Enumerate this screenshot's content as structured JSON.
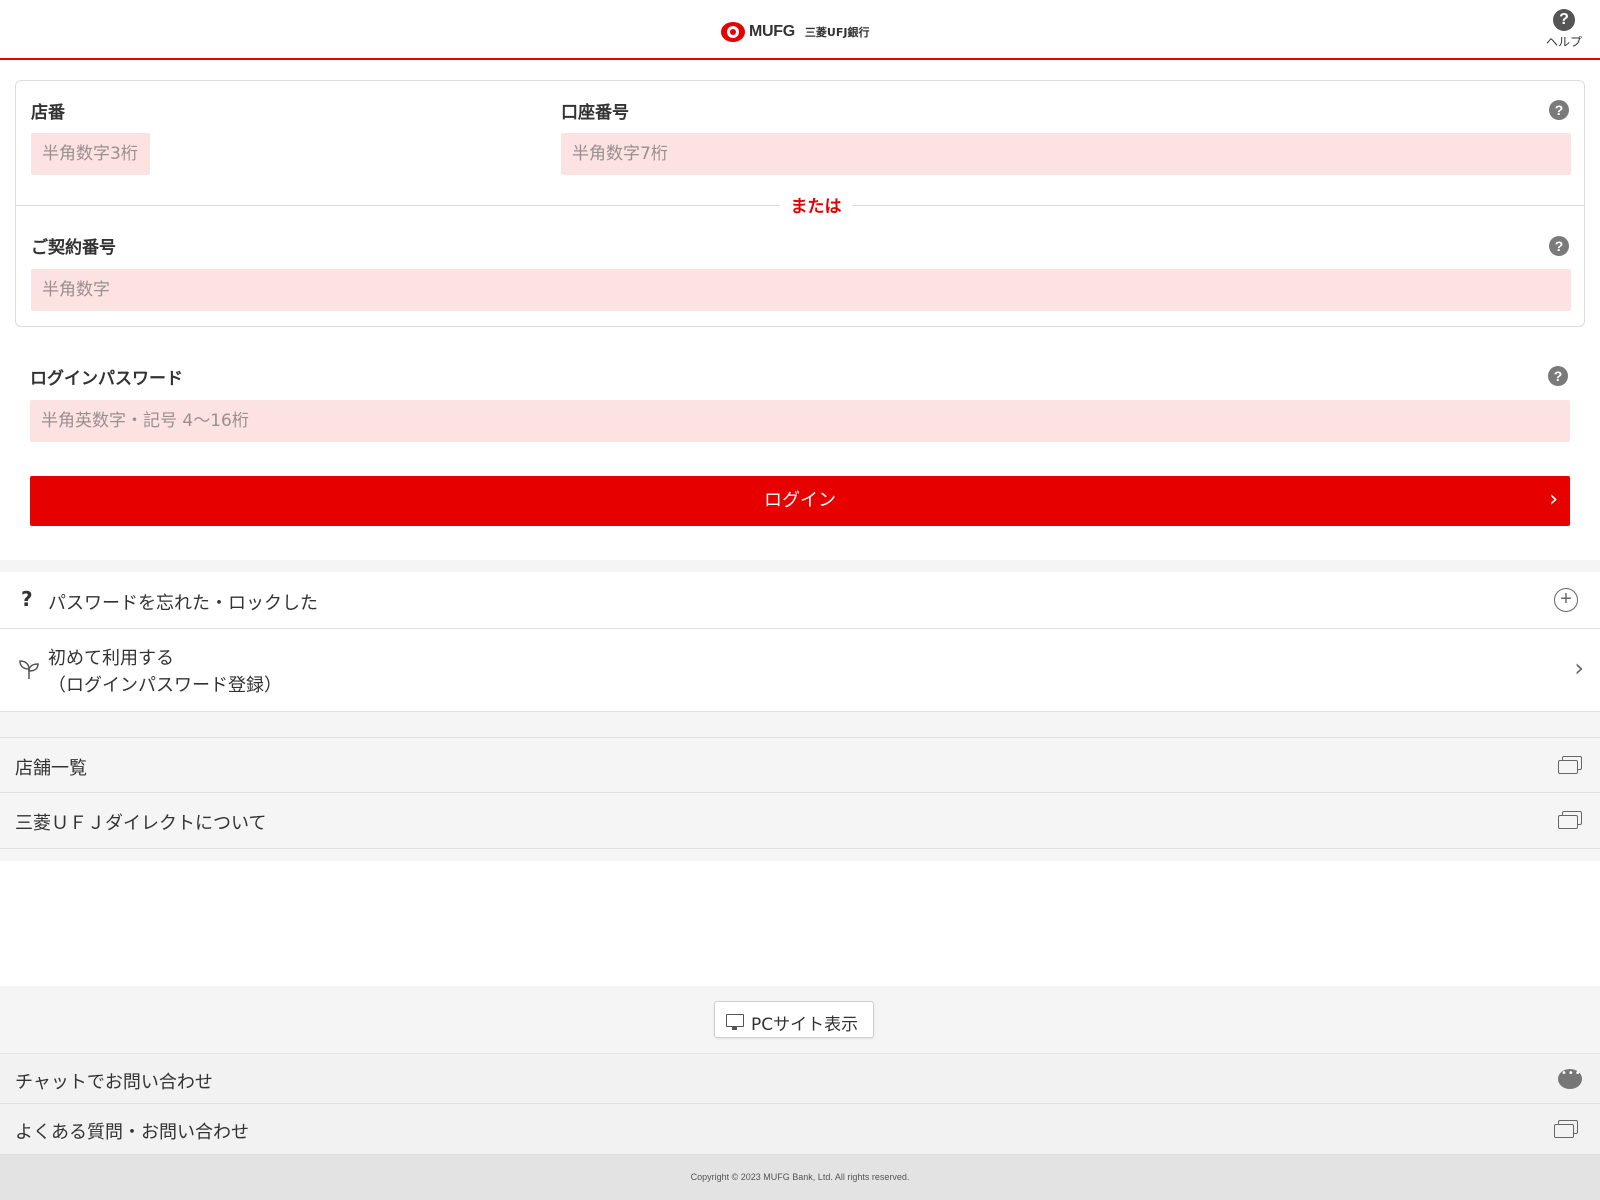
{
  "header": {
    "logo_mufg": "MUFG",
    "logo_bank": "三菱UFJ銀行",
    "help_label": "ヘルプ",
    "accent_color": "#e60000"
  },
  "form": {
    "branch": {
      "label": "店番",
      "placeholder": "半角数字3桁"
    },
    "account": {
      "label": "口座番号",
      "placeholder": "半角数字7桁"
    },
    "or_text": "または",
    "contract": {
      "label": "ご契約番号",
      "placeholder": "半角数字"
    },
    "password": {
      "label": "ログインパスワード",
      "placeholder": "半角英数字・記号 4〜16桁"
    },
    "help_icon": "?",
    "login_button": "ログイン"
  },
  "links": {
    "forgot": {
      "icon": "?",
      "label": "パスワードを忘れた・ロックした"
    },
    "first_use": {
      "line1": "初めて利用する",
      "line2": "（ログインパスワード登録）"
    },
    "branches": "店舗一覧",
    "about": "三菱ＵＦＪダイレクトについて"
  },
  "bottom": {
    "pc_site": "PCサイト表示",
    "chat": "チャットでお問い合わせ",
    "faq": "よくある質問・お問い合わせ"
  },
  "footer": {
    "copyright": "Copyright © 2023 MUFG Bank, Ltd. All rights reserved."
  }
}
